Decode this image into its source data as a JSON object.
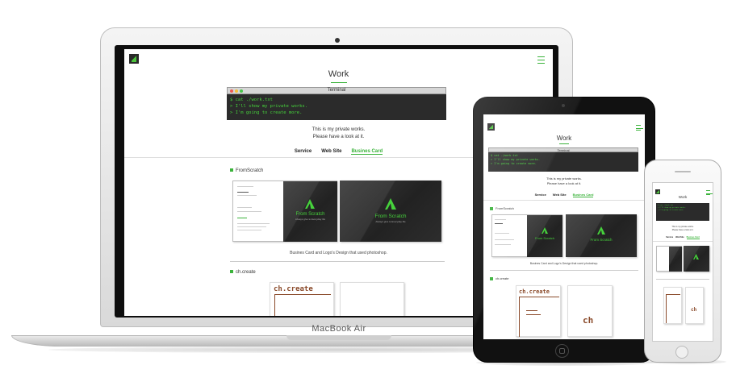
{
  "page": {
    "title": "Work",
    "terminal": {
      "title": "Terminal",
      "lines": [
        "$ cat ./work.txt",
        "> I'll show my private works.",
        "> I'm going to create more."
      ]
    },
    "intro": [
      "This is my private works.",
      "Please have a look at it."
    ],
    "tabs": [
      "Service",
      "Web Site",
      "Busines Card"
    ],
    "active_tab": "Busines Card",
    "sections": {
      "from_scratch": {
        "title": "FromScratch",
        "card_back_label": "From Scratch",
        "card_back_sub": "Always give to Everyday life",
        "caption": "Busines Card and Logo's Design that used photoshop."
      },
      "ch_create": {
        "title": "ch.create",
        "logo_text": "ch.create",
        "card_back_text": "ch"
      }
    }
  },
  "devices": {
    "laptop_brand": "MacBook Air"
  },
  "colors": {
    "accent": "#3bb33b",
    "terminal_text": "#46d23c",
    "brand_brown": "#8a4a2a"
  }
}
